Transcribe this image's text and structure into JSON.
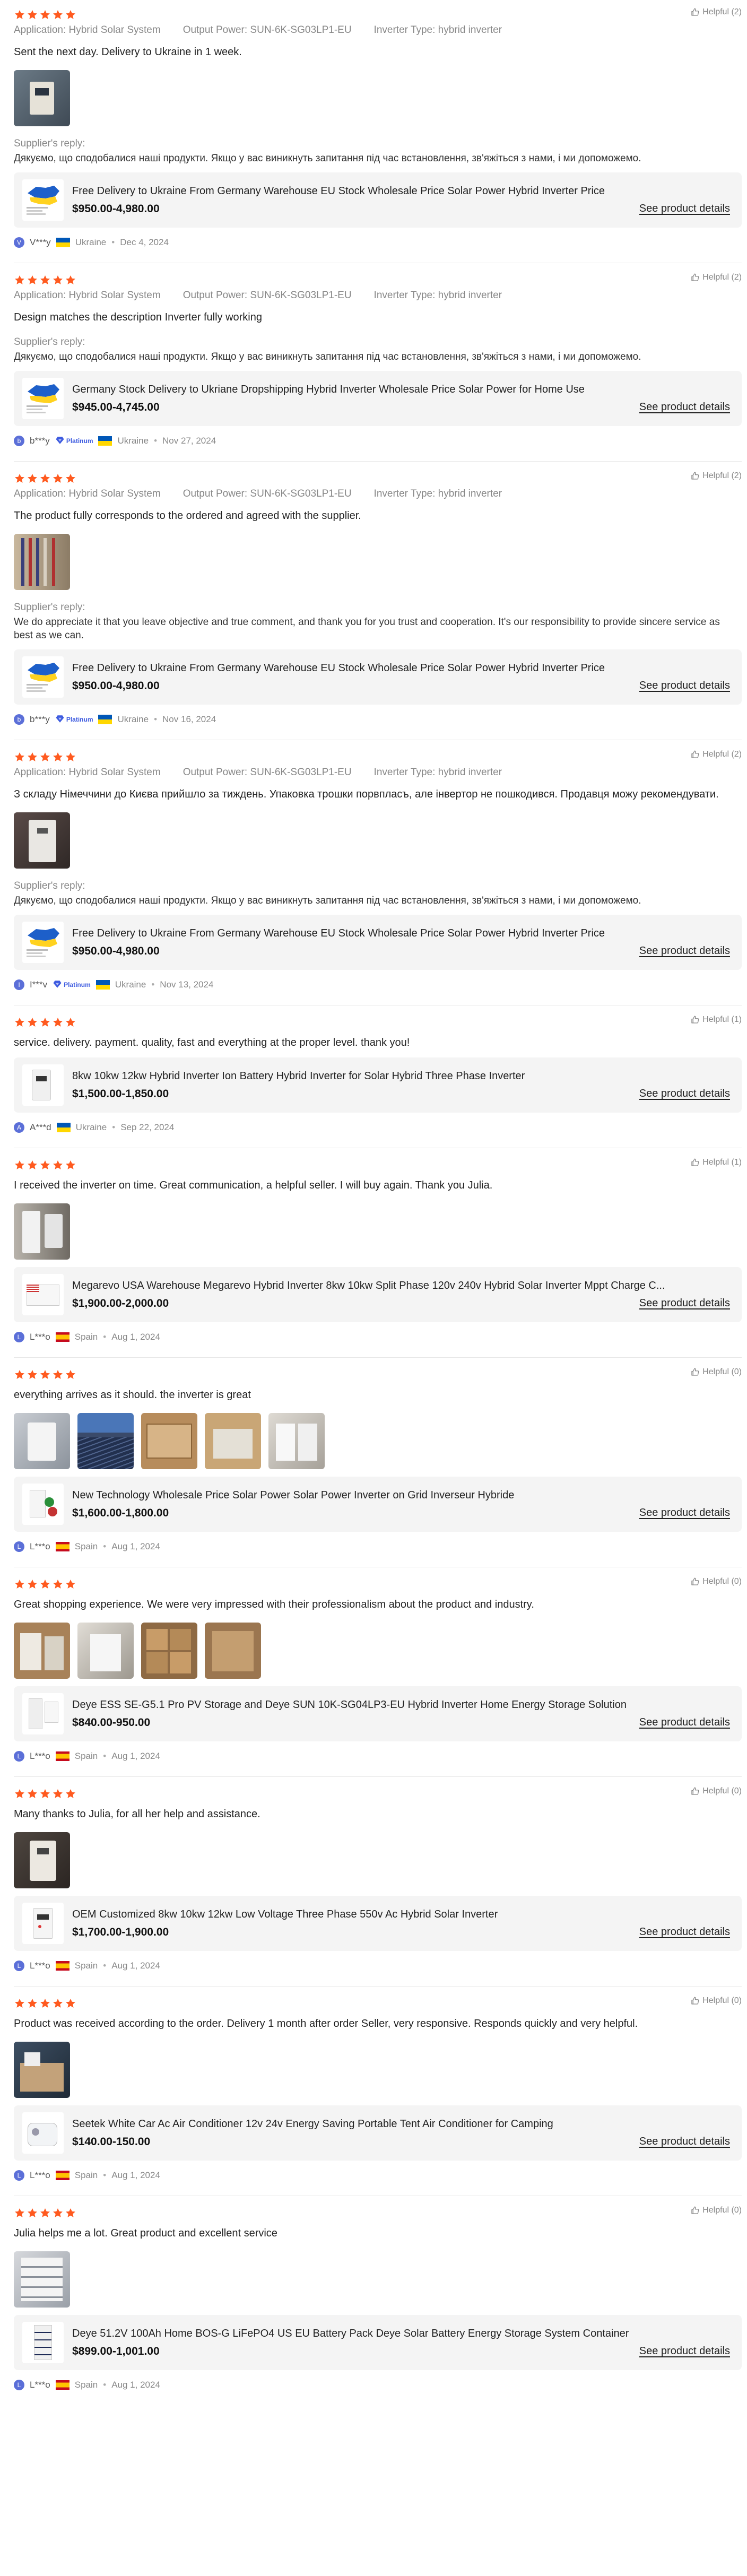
{
  "labels": {
    "application": "Application:",
    "output_power": "Output Power:",
    "inverter_type": "Inverter Type:",
    "supplier_reply": "Supplier's reply:",
    "see_product": "See product details",
    "badge": "Platinum",
    "dot": "•"
  },
  "colors": {
    "star": "#ff5a1f",
    "badge": "#3d5be0",
    "avatar": "#5b6fd8"
  },
  "reviews": [
    {
      "helpful": "Helpful (2)",
      "attrs": {
        "application": "Hybrid Solar System",
        "output_power": "SUN-6K-SG03LP1-EU",
        "inverter_type": "hybrid inverter"
      },
      "comment": "Sent the next day. Delivery to Ukraine in 1 week.",
      "reply": "Дякуємо, що сподобалися наші продукти. Якщо у вас виникнуть запитання під час встановлення, зв'яжіться з нами, і ми допоможемо.",
      "product": {
        "title": "Free Delivery to Ukraine From Germany Warehouse EU Stock Wholesale Price Solar Power Hybrid Inverter Price",
        "price": "$950.00-4,980.00"
      },
      "author": {
        "initial": "V",
        "name": "V***y",
        "country": "Ukraine",
        "date": "Dec 4, 2024",
        "flag": "ua-flag"
      }
    },
    {
      "helpful": "Helpful (2)",
      "attrs": {
        "application": "Hybrid Solar System",
        "output_power": "SUN-6K-SG03LP1-EU",
        "inverter_type": "hybrid inverter"
      },
      "comment": "Design matches the description Inverter fully working",
      "reply": "Дякуємо, що сподобалися наші продукти. Якщо у вас виникнуть запитання під час встановлення, зв'яжіться з нами, і ми допоможемо.",
      "product": {
        "title": "Germany Stock Delivery to Ukriane Dropshipping Hybrid Inverter Wholesale Price Solar Power for Home Use",
        "price": "$945.00-4,745.00"
      },
      "author": {
        "initial": "b",
        "name": "b***y",
        "country": "Ukraine",
        "date": "Nov 27, 2024",
        "flag": "ua-flag"
      }
    },
    {
      "helpful": "Helpful (2)",
      "attrs": {
        "application": "Hybrid Solar System",
        "output_power": "SUN-6K-SG03LP1-EU",
        "inverter_type": "hybrid inverter"
      },
      "comment": "The product fully corresponds to the ordered and agreed with the supplier.",
      "reply": "We do appreciate it that you leave objective and true comment, and thank you for you trust and cooperation. It's our responsibility to provide sincere service as best as we can.",
      "product": {
        "title": "Free Delivery to Ukraine From Germany Warehouse EU Stock Wholesale Price Solar Power Hybrid Inverter Price",
        "price": "$950.00-4,980.00"
      },
      "author": {
        "initial": "b",
        "name": "b***y",
        "country": "Ukraine",
        "date": "Nov 16, 2024",
        "flag": "ua-flag"
      }
    },
    {
      "helpful": "Helpful (2)",
      "attrs": {
        "application": "Hybrid Solar System",
        "output_power": "SUN-6K-SG03LP1-EU",
        "inverter_type": "hybrid inverter"
      },
      "comment": "З складу Німеччини до Києва прийшло за тиждень. Упаковка трошки порвпласъ, але інвертор не пошкодився. Продавця можу рекомендувати.",
      "reply": "Дякуємо, що сподобалися наші продукти. Якщо у вас виникнуть запитання під час встановлення, зв'яжіться з нами, і ми допоможемо.",
      "product": {
        "title": "Free Delivery to Ukraine From Germany Warehouse EU Stock Wholesale Price Solar Power Hybrid Inverter Price",
        "price": "$950.00-4,980.00"
      },
      "author": {
        "initial": "I",
        "name": "I***v",
        "country": "Ukraine",
        "date": "Nov 13, 2024",
        "flag": "ua-flag"
      }
    },
    {
      "helpful": "Helpful (1)",
      "comment": "service. delivery. payment. quality, fast and everything at the proper level. thank you!",
      "product": {
        "title": "8kw 10kw 12kw Hybrid Inverter Ion Battery Hybrid Inverter for Solar Hybrid Three Phase Inverter",
        "price": "$1,500.00-1,850.00"
      },
      "author": {
        "initial": "A",
        "name": "A***d",
        "country": "Ukraine",
        "date": "Sep 22, 2024",
        "flag": "ua-flag"
      }
    },
    {
      "helpful": "Helpful (1)",
      "comment": "I received the inverter on time. Great communication, a helpful seller. I will buy again. Thank you Julia.",
      "product": {
        "title": "Megarevo USA Warehouse Megarevo Hybrid Inverter 8kw 10kw Split Phase 120v 240v Hybrid Solar Inverter Mppt Charge C...",
        "price": "$1,900.00-2,000.00"
      },
      "author": {
        "initial": "L",
        "name": "L***o",
        "country": "Spain",
        "date": "Aug 1, 2024",
        "flag": "es-flag"
      }
    },
    {
      "helpful": "Helpful (0)",
      "comment": "everything arrives as it should. the inverter is great",
      "product": {
        "title": "New Technology Wholesale Price Solar Power Solar Power Inverter on Grid Inverseur Hybride",
        "price": "$1,600.00-1,800.00"
      },
      "author": {
        "initial": "L",
        "name": "L***o",
        "country": "Spain",
        "date": "Aug 1, 2024",
        "flag": "es-flag"
      }
    },
    {
      "helpful": "Helpful (0)",
      "comment": "Great shopping experience. We were very impressed with their professionalism about the product and industry.",
      "product": {
        "title": "Deye ESS SE-G5.1 Pro PV Storage and Deye SUN 10K-SG04LP3-EU Hybrid Inverter Home Energy Storage Solution",
        "price": "$840.00-950.00"
      },
      "author": {
        "initial": "L",
        "name": "L***o",
        "country": "Spain",
        "date": "Aug 1, 2024",
        "flag": "es-flag"
      }
    },
    {
      "helpful": "Helpful (0)",
      "comment": "Many thanks to Julia, for all her help and assistance.",
      "product": {
        "title": "OEM Customized 8kw 10kw 12kw Low Voltage Three Phase 550v Ac Hybrid Solar Inverter",
        "price": "$1,700.00-1,900.00"
      },
      "author": {
        "initial": "L",
        "name": "L***o",
        "country": "Spain",
        "date": "Aug 1, 2024",
        "flag": "es-flag"
      }
    },
    {
      "helpful": "Helpful (0)",
      "comment": "Product was received according to the order. Delivery 1 month after order Seller, very responsive. Responds quickly and very helpful.",
      "product": {
        "title": "Seetek White Car Ac Air Conditioner 12v 24v Energy Saving Portable Tent Air Conditioner for Camping",
        "price": "$140.00-150.00"
      },
      "author": {
        "initial": "L",
        "name": "L***o",
        "country": "Spain",
        "date": "Aug 1, 2024",
        "flag": "es-flag"
      }
    },
    {
      "helpful": "Helpful (0)",
      "comment": "Julia helps me a lot. Great product and excellent service",
      "product": {
        "title": "Deye 51.2V 100Ah Home BOS-G LiFePO4 US EU Battery Pack Deye Solar Battery Energy Storage System Container",
        "price": "$899.00-1,001.00"
      },
      "author": {
        "initial": "L",
        "name": "L***o",
        "country": "Spain",
        "date": "Aug 1, 2024",
        "flag": "es-flag"
      }
    }
  ]
}
